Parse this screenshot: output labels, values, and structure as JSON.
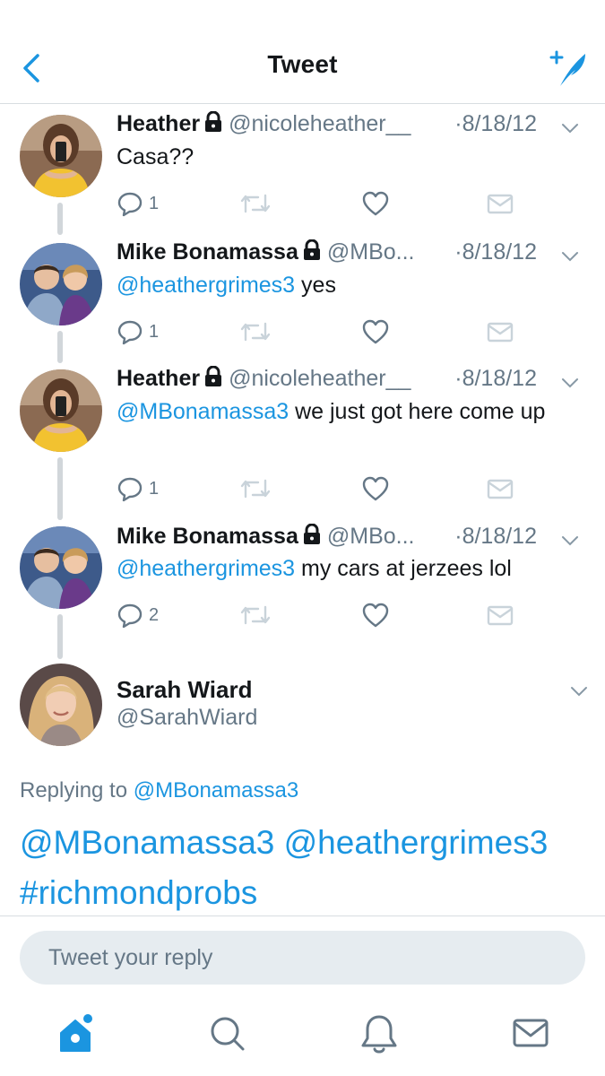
{
  "header": {
    "title": "Tweet"
  },
  "thread": [
    {
      "name": "Heather",
      "handle": "@nicoleheather__",
      "date": "·8/18/12",
      "text_mention": "",
      "text": "Casa??",
      "replies": "1",
      "avatar": "heather-avatar"
    },
    {
      "name": "Mike Bonamassa",
      "handle": "@MBo...",
      "date": "·8/18/12",
      "text_mention": "@heathergrimes3",
      "text": " yes",
      "replies": "1",
      "avatar": "mike-avatar"
    },
    {
      "name": "Heather",
      "handle": "@nicoleheather__",
      "date": "·8/18/12",
      "text_mention": "@MBonamassa3",
      "text": " we just got here come up",
      "replies": "1",
      "avatar": "heather-avatar"
    },
    {
      "name": "Mike Bonamassa",
      "handle": "@MBo...",
      "date": "·8/18/12",
      "text_mention": "@heathergrimes3",
      "text": " my cars at jerzees lol",
      "replies": "2",
      "avatar": "mike-avatar"
    }
  ],
  "main_tweet": {
    "name": "Sarah Wiard",
    "handle": "@SarahWiard",
    "replying_prefix": "Replying to ",
    "replying_to": "@MBonamassa3",
    "text": "@MBonamassa3 @heathergrimes3 #richmondprobs"
  },
  "reply": {
    "placeholder": "Tweet your reply"
  },
  "tabbar": {
    "items": [
      "home-icon",
      "search-icon",
      "notifications-icon",
      "messages-icon"
    ]
  },
  "colors": {
    "accent": "#1b95e0",
    "muted": "#657786",
    "disabled": "#c9d3da",
    "input_bg": "#e6ecf0"
  }
}
